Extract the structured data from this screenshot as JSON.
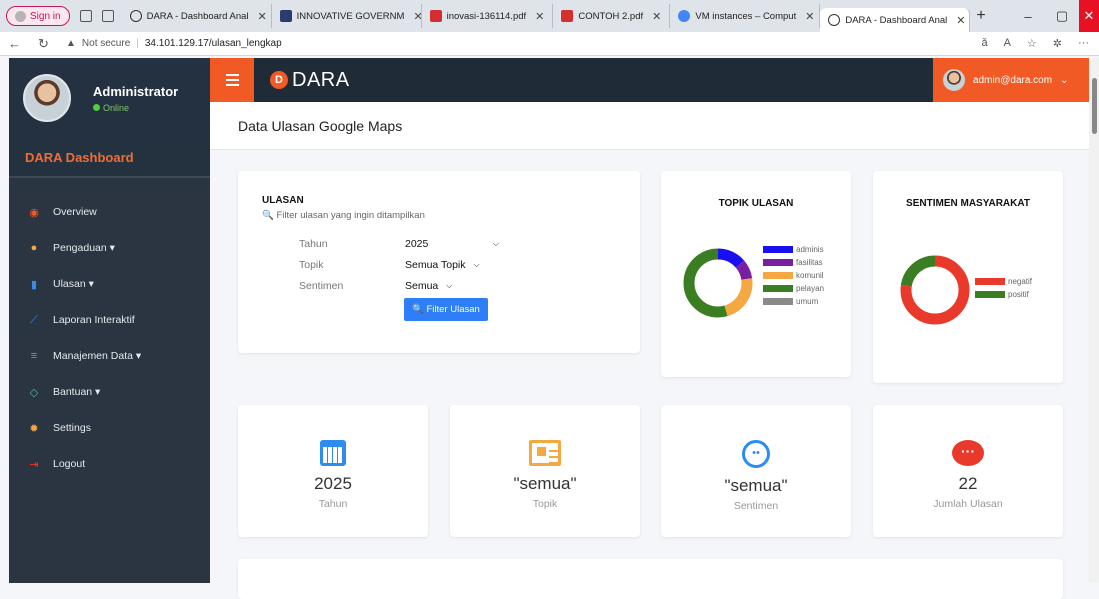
{
  "browser": {
    "signin": "Sign in",
    "tabs": [
      {
        "label": "DARA - Dashboard Anal",
        "active": false
      },
      {
        "label": "INNOVATIVE GOVERNM",
        "active": false
      },
      {
        "label": "inovasi-136114.pdf",
        "active": false
      },
      {
        "label": "CONTOH 2.pdf",
        "active": false
      },
      {
        "label": "VM instances – Comput",
        "active": false
      },
      {
        "label": "DARA - Dashboard Anal",
        "active": true
      }
    ],
    "security": "Not secure",
    "url": "34.101.129.17/ulasan_lengkap"
  },
  "sidebar": {
    "user_name": "Administrator",
    "user_status": "Online",
    "brand": "DARA Dashboard",
    "items": [
      {
        "label": "Overview",
        "icon": "palette-icon"
      },
      {
        "label": "Pengaduan ▾",
        "icon": "chat-icon"
      },
      {
        "label": "Ulasan ▾",
        "icon": "map-icon"
      },
      {
        "label": "Laporan Interaktif",
        "icon": "line-chart-icon"
      },
      {
        "label": "Manajemen Data ▾",
        "icon": "database-icon"
      },
      {
        "label": "Bantuan ▾",
        "icon": "diamond-icon"
      },
      {
        "label": "Settings",
        "icon": "gear-icon"
      },
      {
        "label": "Logout",
        "icon": "logout-icon"
      }
    ]
  },
  "topbar": {
    "logo_letter": "D",
    "logo_text": "DARA",
    "account": "admin@dara.com"
  },
  "page_title": "Data Ulasan Google Maps",
  "filter": {
    "title": "ULASAN",
    "subtitle": "Filter ulasan yang ingin ditampilkan",
    "tahun_label": "Tahun",
    "tahun_value": "2025",
    "topik_label": "Topik",
    "topik_value": "Semua Topik",
    "sentimen_label": "Sentimen",
    "sentimen_value": "Semua",
    "button": "Filter Ulasan"
  },
  "topik_chart": {
    "title": "TOPIK ULASAN",
    "legend": [
      {
        "name": "adminis",
        "color": "#1a0ff0"
      },
      {
        "name": "fasilitas",
        "color": "#7b1fa2"
      },
      {
        "name": "komunil",
        "color": "#f5a742"
      },
      {
        "name": "pelayan",
        "color": "#3a7d22"
      },
      {
        "name": "umum",
        "color": "#8a8a8a"
      }
    ]
  },
  "sentimen_chart": {
    "title": "SENTIMEN MASYARAKAT",
    "legend": [
      {
        "name": "negatif",
        "color": "#e8392b"
      },
      {
        "name": "positif",
        "color": "#3a7d22"
      }
    ]
  },
  "chart_data": [
    {
      "type": "pie",
      "title": "TOPIK ULASAN",
      "categories": [
        "adminis",
        "fasilitas",
        "komunil",
        "pelayan",
        "umum"
      ],
      "values": [
        3,
        2,
        5,
        12,
        0
      ]
    },
    {
      "type": "pie",
      "title": "SENTIMEN MASYARAKAT",
      "categories": [
        "negatif",
        "positif"
      ],
      "values": [
        17,
        5
      ]
    }
  ],
  "stats": [
    {
      "value": "2025",
      "label": "Tahun",
      "icon": "calendar-icon",
      "color": "#2d8cf0"
    },
    {
      "value": "\"semua\"",
      "label": "Topik",
      "icon": "newspaper-icon",
      "color": "#f5a742"
    },
    {
      "value": "\"semua\"",
      "label": "Sentimen",
      "icon": "smile-icon",
      "color": "#2d8cf0"
    },
    {
      "value": "22",
      "label": "Jumlah Ulasan",
      "icon": "comment-icon",
      "color": "#e8392b"
    }
  ]
}
